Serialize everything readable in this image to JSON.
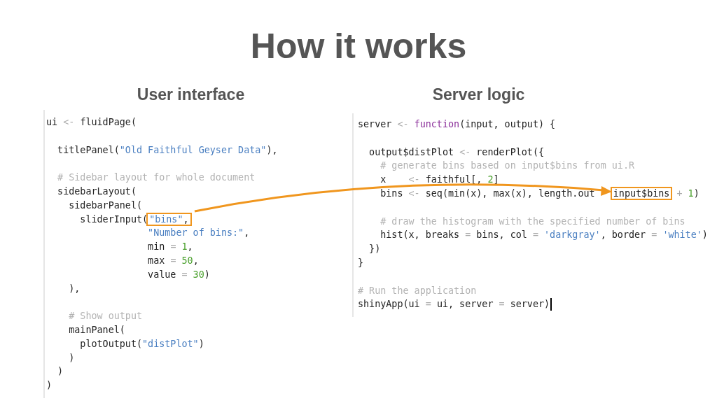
{
  "title": "How it works",
  "panels": [
    {
      "heading": "User interface",
      "blocks": [
        [
          {
            "tokens": [
              {
                "text": "ui ",
                "kind": "plain"
              },
              {
                "text": "<- ",
                "kind": "op"
              },
              {
                "text": "fluidPage(",
                "kind": "plain"
              }
            ]
          }
        ],
        [
          {
            "tokens": [
              {
                "text": "  titlePanel(",
                "kind": "plain"
              },
              {
                "text": "\"Old Faithful Geyser Data\"",
                "kind": "string"
              },
              {
                "text": "),",
                "kind": "plain"
              }
            ]
          }
        ],
        [
          {
            "tokens": [
              {
                "text": "  # Sidebar layout for whole document",
                "kind": "comment"
              }
            ]
          },
          {
            "tokens": [
              {
                "text": "  sidebarLayout(",
                "kind": "plain"
              }
            ]
          },
          {
            "tokens": [
              {
                "text": "    sidebarPanel(",
                "kind": "plain"
              }
            ]
          },
          {
            "tokens": [
              {
                "text": "      sliderInput(",
                "kind": "plain"
              },
              {
                "text": "\"bins\"",
                "kind": "string",
                "boxed": true,
                "box_tail": ","
              }
            ]
          },
          {
            "tokens": [
              {
                "text": "                  \"Number of bins:\"",
                "kind": "string"
              },
              {
                "text": ",",
                "kind": "plain"
              }
            ]
          },
          {
            "tokens": [
              {
                "text": "                  min ",
                "kind": "plain"
              },
              {
                "text": "= ",
                "kind": "op"
              },
              {
                "text": "1",
                "kind": "number"
              },
              {
                "text": ",",
                "kind": "plain"
              }
            ]
          },
          {
            "tokens": [
              {
                "text": "                  max ",
                "kind": "plain"
              },
              {
                "text": "= ",
                "kind": "op"
              },
              {
                "text": "50",
                "kind": "number"
              },
              {
                "text": ",",
                "kind": "plain"
              }
            ]
          },
          {
            "tokens": [
              {
                "text": "                  value ",
                "kind": "plain"
              },
              {
                "text": "= ",
                "kind": "op"
              },
              {
                "text": "30",
                "kind": "number"
              },
              {
                "text": ")",
                "kind": "plain"
              }
            ]
          },
          {
            "tokens": [
              {
                "text": "    ),",
                "kind": "plain"
              }
            ]
          }
        ],
        [
          {
            "tokens": [
              {
                "text": "    # Show output",
                "kind": "comment"
              }
            ]
          },
          {
            "tokens": [
              {
                "text": "    mainPanel(",
                "kind": "plain"
              }
            ]
          },
          {
            "tokens": [
              {
                "text": "      plotOutput(",
                "kind": "plain"
              },
              {
                "text": "\"distPlot\"",
                "kind": "string"
              },
              {
                "text": ")",
                "kind": "plain"
              }
            ]
          },
          {
            "tokens": [
              {
                "text": "    )",
                "kind": "plain"
              }
            ]
          },
          {
            "tokens": [
              {
                "text": "  )",
                "kind": "plain"
              }
            ]
          },
          {
            "tokens": [
              {
                "text": ")",
                "kind": "plain"
              }
            ]
          }
        ]
      ]
    },
    {
      "heading": "Server logic",
      "blocks": [
        [
          {
            "tokens": [
              {
                "text": "server ",
                "kind": "plain"
              },
              {
                "text": "<- ",
                "kind": "op"
              },
              {
                "text": "function",
                "kind": "keyword"
              },
              {
                "text": "(input, output) {",
                "kind": "plain"
              }
            ]
          }
        ],
        [
          {
            "tokens": [
              {
                "text": "  output$distPlot ",
                "kind": "plain"
              },
              {
                "text": "<- ",
                "kind": "op"
              },
              {
                "text": "renderPlot({",
                "kind": "plain"
              }
            ]
          },
          {
            "tokens": [
              {
                "text": "    # generate bins based on input$bins from ui.R",
                "kind": "comment"
              }
            ]
          },
          {
            "tokens": [
              {
                "text": "    x    ",
                "kind": "plain"
              },
              {
                "text": "<- ",
                "kind": "op"
              },
              {
                "text": "faithful[, ",
                "kind": "plain"
              },
              {
                "text": "2",
                "kind": "number"
              },
              {
                "text": "]",
                "kind": "plain"
              }
            ]
          },
          {
            "tokens": [
              {
                "text": "    bins ",
                "kind": "plain"
              },
              {
                "text": "<- ",
                "kind": "op"
              },
              {
                "text": "seq(min(x), max(x), length.out   ",
                "kind": "plain"
              },
              {
                "text": "input$bins",
                "kind": "plain",
                "boxed": true
              },
              {
                "text": " + ",
                "kind": "op"
              },
              {
                "text": "1",
                "kind": "number"
              },
              {
                "text": ")",
                "kind": "plain"
              }
            ]
          }
        ],
        [
          {
            "tokens": [
              {
                "text": "    # draw the histogram with the specified number of bins",
                "kind": "comment"
              }
            ]
          },
          {
            "tokens": [
              {
                "text": "    hist(x, breaks ",
                "kind": "plain"
              },
              {
                "text": "= ",
                "kind": "op"
              },
              {
                "text": "bins, col ",
                "kind": "plain"
              },
              {
                "text": "= ",
                "kind": "op"
              },
              {
                "text": "'darkgray'",
                "kind": "string"
              },
              {
                "text": ", border ",
                "kind": "plain"
              },
              {
                "text": "= ",
                "kind": "op"
              },
              {
                "text": "'white'",
                "kind": "string"
              },
              {
                "text": ")",
                "kind": "plain"
              }
            ]
          },
          {
            "tokens": [
              {
                "text": "  })",
                "kind": "plain"
              }
            ]
          },
          {
            "tokens": [
              {
                "text": "}",
                "kind": "plain"
              }
            ]
          }
        ],
        [
          {
            "tokens": [
              {
                "text": "# Run the application",
                "kind": "comment"
              }
            ]
          },
          {
            "tokens": [
              {
                "text": "shinyApp(ui ",
                "kind": "plain"
              },
              {
                "text": "= ",
                "kind": "op"
              },
              {
                "text": "ui, server ",
                "kind": "plain"
              },
              {
                "text": "= ",
                "kind": "op"
              },
              {
                "text": "server)",
                "kind": "plain"
              }
            ],
            "cursor": true
          }
        ]
      ]
    }
  ]
}
